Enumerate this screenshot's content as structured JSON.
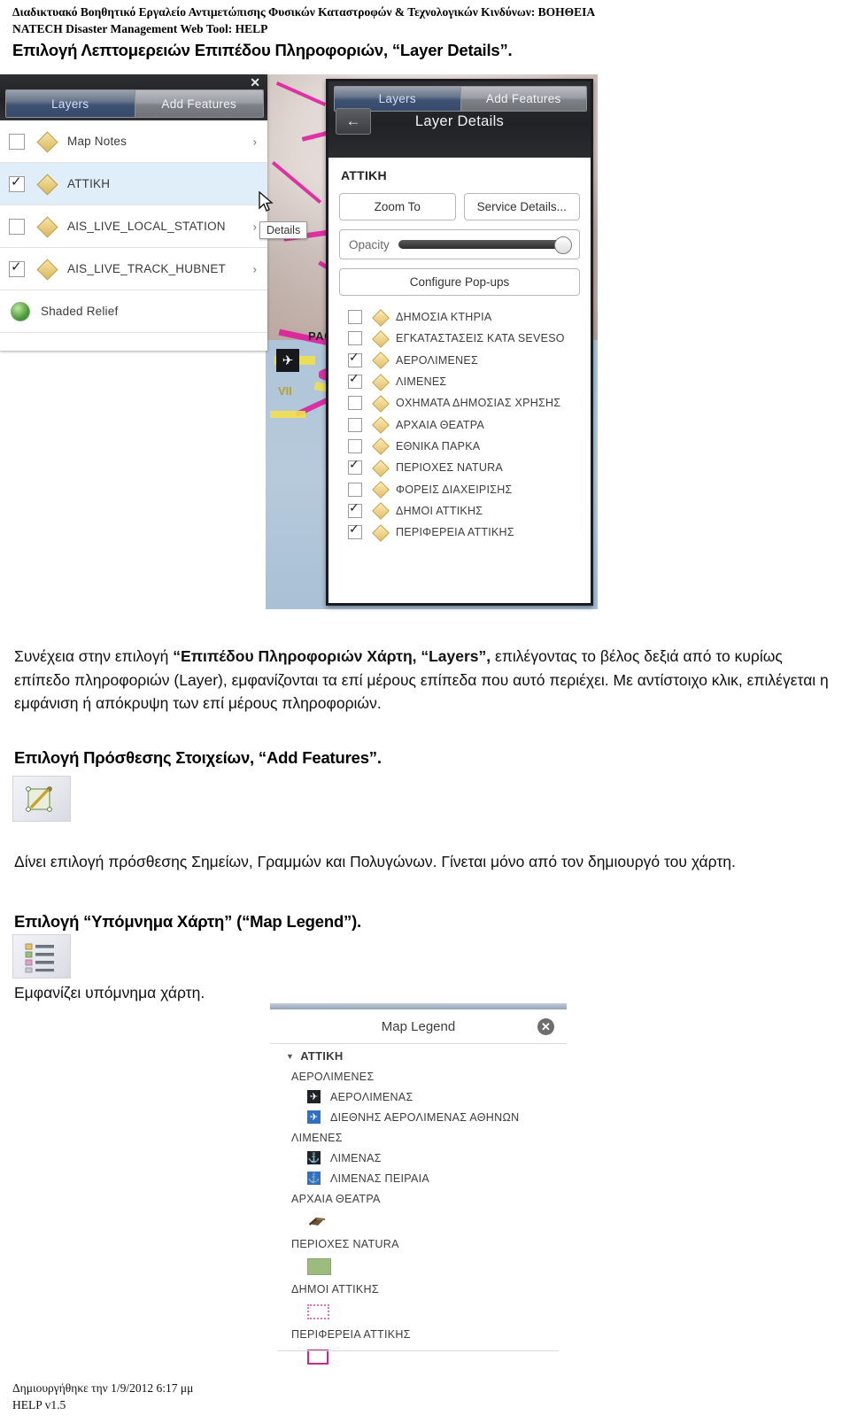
{
  "doc_header": {
    "line1": "Διαδικτυακό Βοηθητικό Εργαλείο Αντιμετώπισης Φυσικών Καταστροφών & Τεχνολογικών Κινδύνων: ΒΟΗΘΕΙΑ",
    "line2": "NATECH Disaster Management Web Tool: HELP"
  },
  "headings": {
    "layer_details": "Επιλογή Λεπτομερειών Επιπέδου Πληροφοριών, “Layer Details”.",
    "add_features": "Επιλογή Πρόσθεσης Στοιχείων, “Add Features”.",
    "map_legend": "Επιλογή “Υπόμνημα Χάρτη” (“Map Legend”)."
  },
  "paragraphs": {
    "p1_a": "Συνέχεια στην επιλογή ",
    "p1_b": "“Επιπέδου Πληροφοριών Χάρτη, “Layers”,",
    "p1_c": " επιλέγοντας το βέλος δεξιά από το κυρίως επίπεδο πληροφοριών (Layer), εμφανίζονται τα επί μέρους επίπεδα που αυτό περιέχει. Με αντίστοιχο κλικ, επιλέγεται η εμφάνιση ή απόκρυψη των επί μέρους πληροφοριών.",
    "p2": "Δίνει επιλογή πρόσθεσης Σημείων, Γραμμών και Πολυγώνων. Γίνεται μόνο από τον δημιουργό του χάρτη.",
    "p3": "Εμφανίζει υπόμνημα χάρτη."
  },
  "layers_panel": {
    "close_label": "✕",
    "tabs": [
      {
        "label": "Layers",
        "active": true
      },
      {
        "label": "Add Features",
        "active": false
      }
    ],
    "rows": [
      {
        "label": "Map Notes",
        "checked": false,
        "has_chevron": true,
        "selected": false,
        "icon": "diamond-layer-icon"
      },
      {
        "label": "ΑΤΤΙΚΗ",
        "checked": true,
        "has_chevron": false,
        "selected": true,
        "icon": "diamond-layer-icon"
      },
      {
        "label": "AIS_LIVE_LOCAL_STATION",
        "checked": false,
        "has_chevron": true,
        "selected": false,
        "icon": "diamond-layer-icon"
      },
      {
        "label": "AIS_LIVE_TRACK_HUBNET",
        "checked": true,
        "has_chevron": true,
        "selected": false,
        "icon": "diamond-layer-icon"
      },
      {
        "label": "Shaded Relief",
        "checked": null,
        "has_chevron": false,
        "selected": false,
        "icon": "globe-icon"
      }
    ],
    "tooltip": "Details",
    "chevron_glyph": "›"
  },
  "details_panel": {
    "tabs": [
      {
        "label": "Layers",
        "active": true
      },
      {
        "label": "Add Features",
        "active": false
      }
    ],
    "back_glyph": "←",
    "title": "Layer Details",
    "layer_name": "ΑΤΤΙΚΗ",
    "zoom_to": "Zoom To",
    "service_details": "Service Details...",
    "opacity_label": "Opacity",
    "opacity_value": 100,
    "configure_popups": "Configure Pop-ups",
    "sublayers": [
      {
        "label": "ΔΗΜΟΣΙΑ ΚΤΗΡΙΑ",
        "checked": false
      },
      {
        "label": "ΕΓΚΑΤΑΣΤΑΣΕΙΣ ΚΑΤΑ SEVESO",
        "checked": false
      },
      {
        "label": "ΑΕΡΟΛΙΜΕΝΕΣ",
        "checked": true
      },
      {
        "label": "ΛΙΜΕΝΕΣ",
        "checked": true
      },
      {
        "label": "ΟΧΗΜΑΤΑ ΔΗΜΟΣΙΑΣ ΧΡΗΣΗΣ",
        "checked": false
      },
      {
        "label": "ΑΡΧΑΙΑ ΘΕΑΤΡΑ",
        "checked": false
      },
      {
        "label": "ΕΘΝΙΚΑ ΠΑΡΚΑ",
        "checked": false
      },
      {
        "label": "ΠΕΡΙΟΧΕΣ NATURA",
        "checked": true
      },
      {
        "label": "ΦΟΡΕΙΣ ΔΙΑΧΕΙΡΙΣΗΣ",
        "checked": false
      },
      {
        "label": "ΔΗΜΟΙ ΑΤΤΙΚΗΣ",
        "checked": true
      },
      {
        "label": "ΠΕΡΙΦΕΡΕΙΑ ΑΤΤΙΚΗΣ",
        "checked": true
      }
    ]
  },
  "map": {
    "label_pach": "PACH",
    "label_vii": "VII",
    "colors": {
      "magenta": "#e0149b",
      "yellow": "#f2df4c",
      "terrain": "#b9a59d",
      "sea": "#aec4d8"
    }
  },
  "map_legend": {
    "title": "Map Legend",
    "close_glyph": "✕",
    "root": "ΑΤΤΙΚΗ",
    "triangle_glyph": "▼",
    "groups": [
      {
        "name": "ΑΕΡΟΛΙΜΕΝΕΣ",
        "items": [
          {
            "label": "ΑΕΡΟΛΙΜΕΝΑΣ",
            "symbol": "airport-dark-icon"
          },
          {
            "label": "ΔΙΕΘΝΗΣ ΑΕΡΟΛΙΜΕΝΑΣ ΑΘΗΝΩΝ",
            "symbol": "airport-blue-icon"
          }
        ]
      },
      {
        "name": "ΛΙΜΕΝΕΣ",
        "items": [
          {
            "label": "ΛΙΜΕΝΑΣ",
            "symbol": "anchor-dark-icon"
          },
          {
            "label": "ΛΙΜΕΝΑΣ ΠΕΙΡΑΙΑ",
            "symbol": "anchor-blue-icon"
          }
        ]
      },
      {
        "name": "ΑΡΧΑΙΑ ΘΕΑΤΡΑ",
        "items": [],
        "swatch": "theatre-icon"
      },
      {
        "name": "ΠΕΡΙΟΧΕΣ NATURA",
        "items": [],
        "swatch": "green-fill-swatch"
      },
      {
        "name": "ΔΗΜΟΙ ΑΤΤΙΚΗΣ",
        "items": [],
        "swatch": "pink-dashed-swatch"
      },
      {
        "name": "ΠΕΡΙΦΕΡΕΙΑ ΑΤΤΙΚΗΣ",
        "items": [],
        "swatch": "magenta-outline-swatch"
      }
    ]
  },
  "toolbar_icons": {
    "add_features": "add-features-polygon-icon",
    "map_legend": "map-legend-list-icon"
  },
  "footer": {
    "line1": "Δημιουργήθηκε την 1/9/2012 6:17 μμ",
    "line2": "HELP v1.5"
  }
}
